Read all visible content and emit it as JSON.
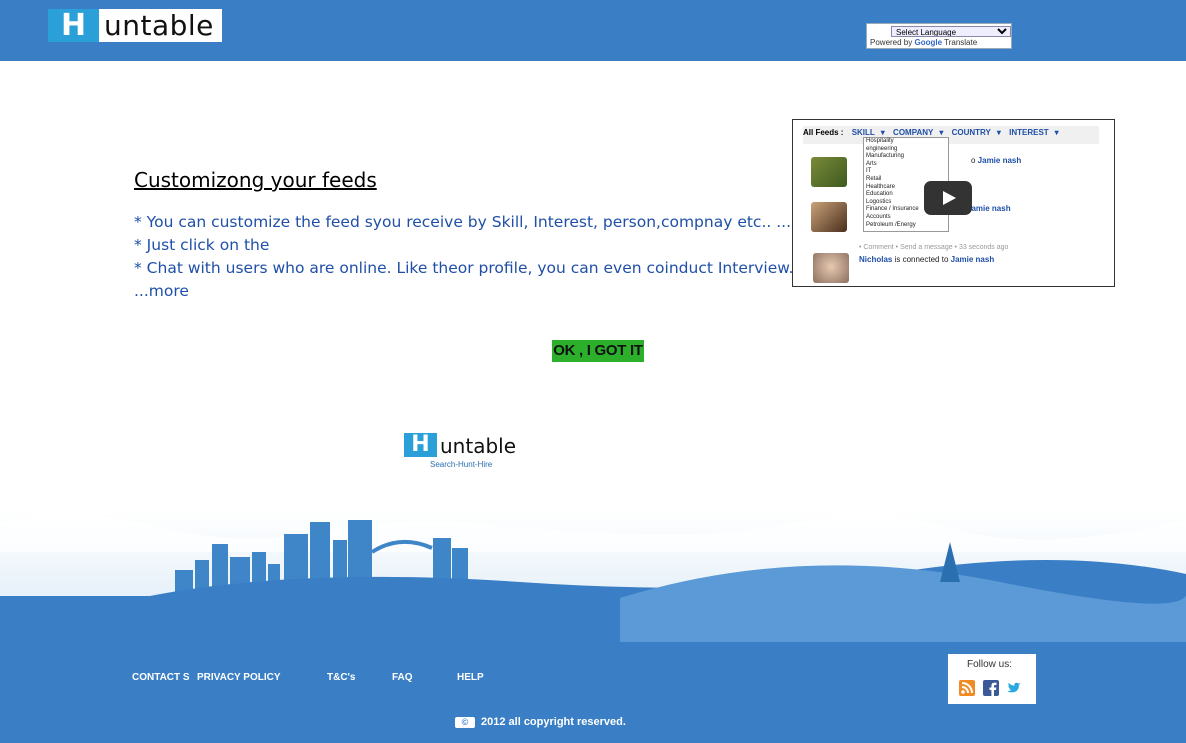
{
  "header": {
    "logo_letter": "H",
    "logo_text": "untable",
    "language_select": "Select Language",
    "powered_by": "Powered by",
    "google": "Google",
    "translate": "Translate"
  },
  "content": {
    "title": "Customizong your feeds",
    "bullets": [
      "* You can customize the feed syou receive by Skill, Interest, person,compnay etc.. ...",
      "* Just click on the",
      "* Chat with users who are online. Like theor profile, you can even coinduct Interview.",
      "...more"
    ],
    "ok_button": "OK , I GOT IT"
  },
  "video": {
    "feeds_label": "All Feeds :",
    "filters": [
      "SKILL",
      "COMPANY",
      "COUNTRY",
      "INTEREST"
    ],
    "skills": [
      "Hospitality",
      "engineering",
      "Manufacturing",
      "Arts",
      "IT",
      "Retail",
      "Healthcare",
      "Education",
      "Logostics",
      "Finance / Insurance",
      "Accounts",
      "Petroleum /Energy"
    ],
    "row1_target": "Jamie nash",
    "row2_target": "Jamie nash",
    "meta": "• Comment  • Send a message  • 33 seconds ago",
    "row3_name": "Nicholas",
    "row3_text": "is connected to",
    "row3_target": "Jamie nash"
  },
  "brand": {
    "letter": "H",
    "text": "untable",
    "tagline": "Search-Hunt-Hire"
  },
  "footer": {
    "links": [
      "CONTACT S",
      "PRIVACY POLICY",
      "T&C's",
      "FAQ",
      "HELP"
    ],
    "follow_us": "Follow us:",
    "copyright_icon": "©",
    "copyright": "2012 all copyright reserved."
  },
  "colors": {
    "header_blue": "#3a7fc6",
    "text_blue": "#1f4fa8",
    "ok_green": "#2cb02c"
  }
}
